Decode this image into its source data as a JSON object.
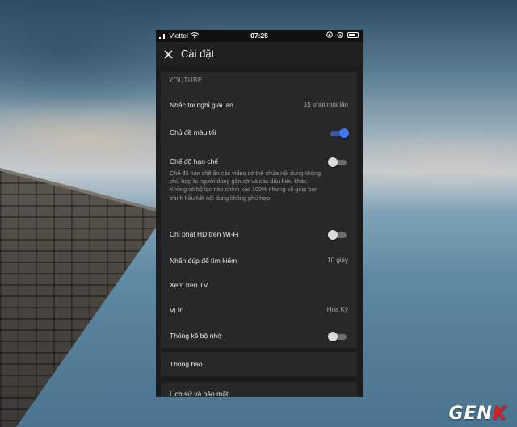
{
  "status_bar": {
    "carrier": "Viettel",
    "time": "07:25"
  },
  "header": {
    "title": "Cài đặt"
  },
  "youtube_section": {
    "header": "YOUTUBE",
    "rows": [
      {
        "label": "Nhắc tôi nghỉ giải lao",
        "value": "15 phút một lần"
      },
      {
        "label": "Chủ đề màu tối",
        "toggle": true
      },
      {
        "label": "Chế độ hạn chế",
        "toggle": false
      },
      {
        "label": "Chỉ phát HD trên Wi-Fi",
        "toggle": false
      },
      {
        "label": "Nhấn đúp để tìm kiếm",
        "value": "10 giây"
      },
      {
        "label": "Xem trên TV"
      },
      {
        "label": "Vị trí",
        "value": "Hoa Kỳ"
      },
      {
        "label": "Thống kê bộ nhớ",
        "toggle": false
      }
    ],
    "restricted_description": "Chế độ hạn chế ẩn các video có thể chứa nội dung không phù hợp bị người dùng gắn cờ và các dấu hiệu khác. Không có bộ lọc nào chính xác 100% nhưng sẽ giúp bạn tránh hầu hết nội dung không phù hợp."
  },
  "notifications": {
    "label": "Thông báo"
  },
  "history": {
    "label": "Lịch sử và bảo mật"
  },
  "watermark": {
    "brand_main": "GEN",
    "brand_accent": "K"
  },
  "colors": {
    "toggle_on": "#3f7af4",
    "card_bg": "#282828",
    "screen_bg": "#1c1c1c",
    "watermark_accent": "#e11b22"
  }
}
